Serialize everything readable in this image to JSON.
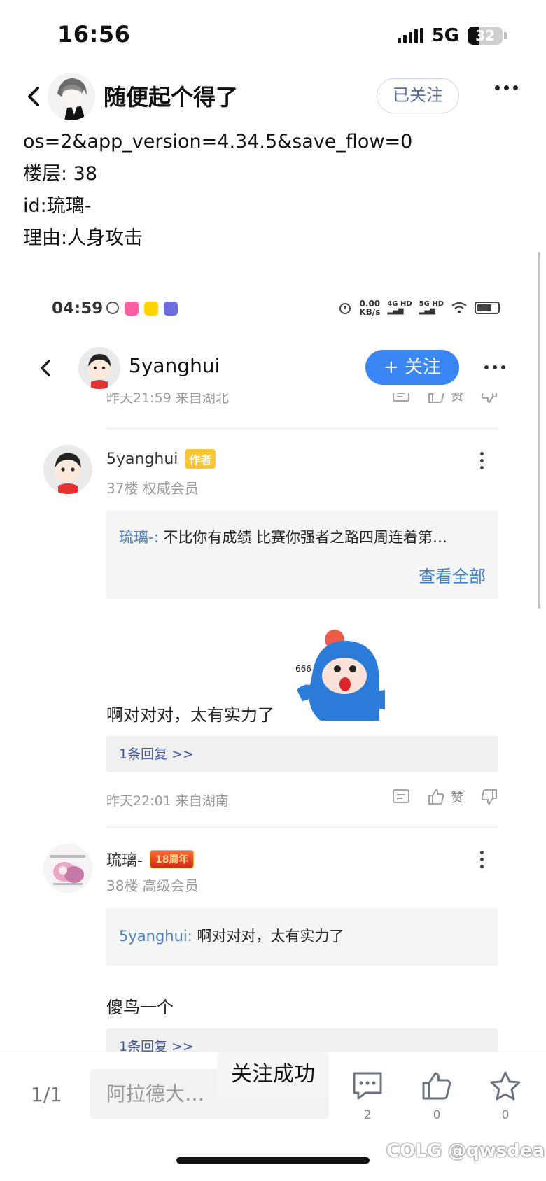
{
  "status": {
    "time": "16:56",
    "network": "5G",
    "battery": "32",
    "battery_level": 0.32
  },
  "header": {
    "author_name": "随便起个得了",
    "follow_label": "已关注"
  },
  "post": {
    "lines": [
      "os=2&app_version=4.34.5&save_flow=0",
      "楼层: 38",
      "id:琉璃-",
      "理由:人身攻击"
    ]
  },
  "screenshot": {
    "status_time": "04:59",
    "speed_value": "0.00",
    "speed_unit": "KB/s",
    "sig1_label": "4G HD",
    "sig2_label": "5G HD",
    "nav": {
      "user_name": "5yanghui",
      "follow_label": "+ 关注"
    },
    "prev_meta": {
      "time": "昨天21:59 来自湖北",
      "like_label": "赞"
    },
    "comments": [
      {
        "user": "5yanghui",
        "tag": "作者",
        "sub": "37楼 权威会员",
        "quote_name": "琉璃-:",
        "quote_text": " 不比你有成绩 比赛你强者之路四周连着第…",
        "view_all": "查看全部",
        "body": "啊对对对，太有实力了",
        "reply_link": "1条回复 >>",
        "time": "昨天22:01 来自湖南",
        "like_label": "赞"
      },
      {
        "user": "琉璃-",
        "tag": "18周年",
        "sub": "38楼 高级会员",
        "quote_name": "5yanghui:",
        "quote_text": " 啊对对对，太有实力了",
        "body": "傻鸟一个",
        "reply_link": "1条回复 >>"
      }
    ]
  },
  "bottom": {
    "page_indicator": "1/1",
    "input_placeholder": "阿拉德大…",
    "toast": "关注成功",
    "comment_count": "2",
    "like_count": "0",
    "star_count": "0"
  },
  "watermark": "COLG @qwsdea"
}
